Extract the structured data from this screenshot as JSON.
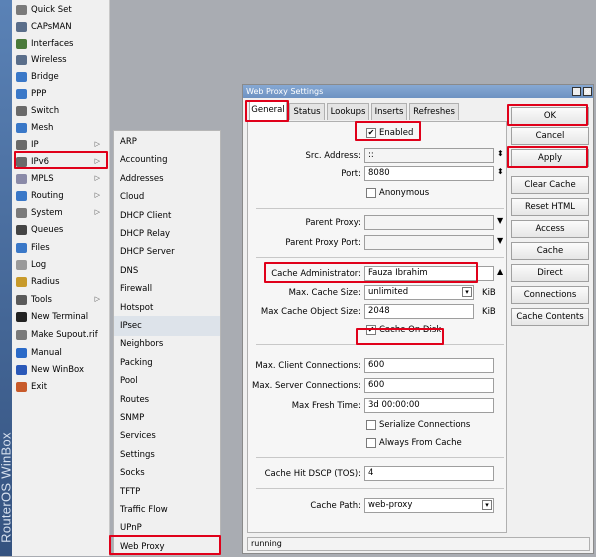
{
  "app": {
    "brand": "RouterOS WinBox"
  },
  "main_menu": [
    {
      "label": "Quick Set",
      "icon": "quick-set-icon",
      "color": "#7a7a7a"
    },
    {
      "label": "CAPsMAN",
      "icon": "capsman-icon",
      "color": "#5a6e8a"
    },
    {
      "label": "Interfaces",
      "icon": "interfaces-icon",
      "color": "#4a7a3a"
    },
    {
      "label": "Wireless",
      "icon": "wireless-icon",
      "color": "#5a6e8a"
    },
    {
      "label": "Bridge",
      "icon": "bridge-icon",
      "color": "#3a78c8"
    },
    {
      "label": "PPP",
      "icon": "ppp-icon",
      "color": "#3a78c8"
    },
    {
      "label": "Switch",
      "icon": "switch-icon",
      "color": "#6a6a6a"
    },
    {
      "label": "Mesh",
      "icon": "mesh-icon",
      "color": "#3a78c8"
    },
    {
      "label": "IP",
      "icon": "ip-icon",
      "color": "#6a6a6a",
      "arrow": "▷"
    },
    {
      "label": "IPv6",
      "icon": "ipv6-icon",
      "color": "#6a6a6a",
      "arrow": "▷"
    },
    {
      "label": "MPLS",
      "icon": "mpls-icon",
      "color": "#8a8aa8",
      "arrow": "▷"
    },
    {
      "label": "Routing",
      "icon": "routing-icon",
      "color": "#3a78c8",
      "arrow": "▷"
    },
    {
      "label": "System",
      "icon": "system-icon",
      "color": "#7a7a7a",
      "arrow": "▷"
    },
    {
      "label": "Queues",
      "icon": "queues-icon",
      "color": "#444444"
    },
    {
      "label": "Files",
      "icon": "files-icon",
      "color": "#3a78c8"
    },
    {
      "label": "Log",
      "icon": "log-icon",
      "color": "#9a9a9a"
    },
    {
      "label": "Radius",
      "icon": "radius-icon",
      "color": "#c89a2a"
    },
    {
      "label": "Tools",
      "icon": "tools-icon",
      "color": "#5a5a5a",
      "arrow": "▷"
    },
    {
      "label": "New Terminal",
      "icon": "terminal-icon",
      "color": "#222222"
    },
    {
      "label": "Make Supout.rif",
      "icon": "supout-icon",
      "color": "#7a7a7a"
    },
    {
      "label": "Manual",
      "icon": "manual-icon",
      "color": "#2a6ac8"
    },
    {
      "label": "New WinBox",
      "icon": "winbox-icon",
      "color": "#2a58b8"
    },
    {
      "label": "Exit",
      "icon": "exit-icon",
      "color": "#c85a2a"
    }
  ],
  "ip_submenu": [
    "ARP",
    "Accounting",
    "Addresses",
    "Cloud",
    "DHCP Client",
    "DHCP Relay",
    "DHCP Server",
    "DNS",
    "Firewall",
    "Hotspot",
    "IPsec",
    "Neighbors",
    "Packing",
    "Pool",
    "Routes",
    "SNMP",
    "Services",
    "Settings",
    "Socks",
    "TFTP",
    "Traffic Flow",
    "UPnP",
    "Web Proxy"
  ],
  "window": {
    "title": "Web Proxy Settings",
    "tabs": [
      "General",
      "Status",
      "Lookups",
      "Inserts",
      "Refreshes"
    ],
    "enabled_label": "Enabled",
    "enabled_checked": true,
    "fields": {
      "src_address": {
        "label": "Src. Address:",
        "value": "::"
      },
      "port": {
        "label": "Port:",
        "value": "8080"
      },
      "anonymous": {
        "label": "Anonymous",
        "checked": false
      },
      "parent_proxy": {
        "label": "Parent Proxy:",
        "value": ""
      },
      "parent_proxy_port": {
        "label": "Parent Proxy Port:",
        "value": ""
      },
      "cache_admin": {
        "label": "Cache Administrator:",
        "value": "Fauza Ibrahim"
      },
      "max_cache_size": {
        "label": "Max. Cache Size:",
        "value": "unlimited",
        "unit": "KiB"
      },
      "max_cache_obj": {
        "label": "Max Cache Object Size:",
        "value": "2048",
        "unit": "KiB"
      },
      "cache_on_disk": {
        "label": "Cache On Disk",
        "checked": true
      },
      "max_client_conn": {
        "label": "Max. Client Connections:",
        "value": "600"
      },
      "max_server_conn": {
        "label": "Max. Server Connections:",
        "value": "600"
      },
      "max_fresh_time": {
        "label": "Max Fresh Time:",
        "value": "3d 00:00:00"
      },
      "serialize_conn": {
        "label": "Serialize Connections",
        "checked": false
      },
      "always_from_cache": {
        "label": "Always From Cache",
        "checked": false
      },
      "cache_hit_dscp": {
        "label": "Cache Hit DSCP (TOS):",
        "value": "4"
      },
      "cache_path": {
        "label": "Cache Path:",
        "value": "web-proxy"
      }
    },
    "buttons": [
      "OK",
      "Cancel",
      "Apply",
      "Clear Cache",
      "Reset HTML",
      "Access",
      "Cache",
      "Direct",
      "Connections",
      "Cache Contents"
    ],
    "status": "running"
  },
  "highlight_color": "#e0001a"
}
